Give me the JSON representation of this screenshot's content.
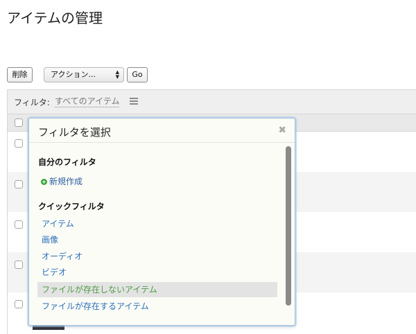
{
  "page": {
    "title": "アイテムの管理"
  },
  "toolbar": {
    "delete_label": "削除",
    "action_select": {
      "selected": "アクション..."
    },
    "go_label": "Go"
  },
  "filter_bar": {
    "label": "フィルタ:",
    "current": "すべてのアイテム",
    "icon": "list-icon"
  },
  "filter_popover": {
    "title": "フィルタを選択",
    "close_icon": "close-icon",
    "my_filters": {
      "heading": "自分のフィルタ",
      "new_label": "新規作成",
      "new_icon": "plus-circle-icon"
    },
    "quick_filters": {
      "heading": "クイックフィルタ",
      "items": [
        {
          "label": "アイテム"
        },
        {
          "label": "画像"
        },
        {
          "label": "オーディオ"
        },
        {
          "label": "ビデオ"
        },
        {
          "label": "ファイルが存在しないアイテム"
        },
        {
          "label": "ファイルが存在するアイテム"
        }
      ]
    }
  },
  "colors": {
    "link": "#2a6fb8",
    "highlight_text": "#4e9a43",
    "highlight_bg": "#e3e3e3",
    "add_icon": "#3aa63a"
  }
}
